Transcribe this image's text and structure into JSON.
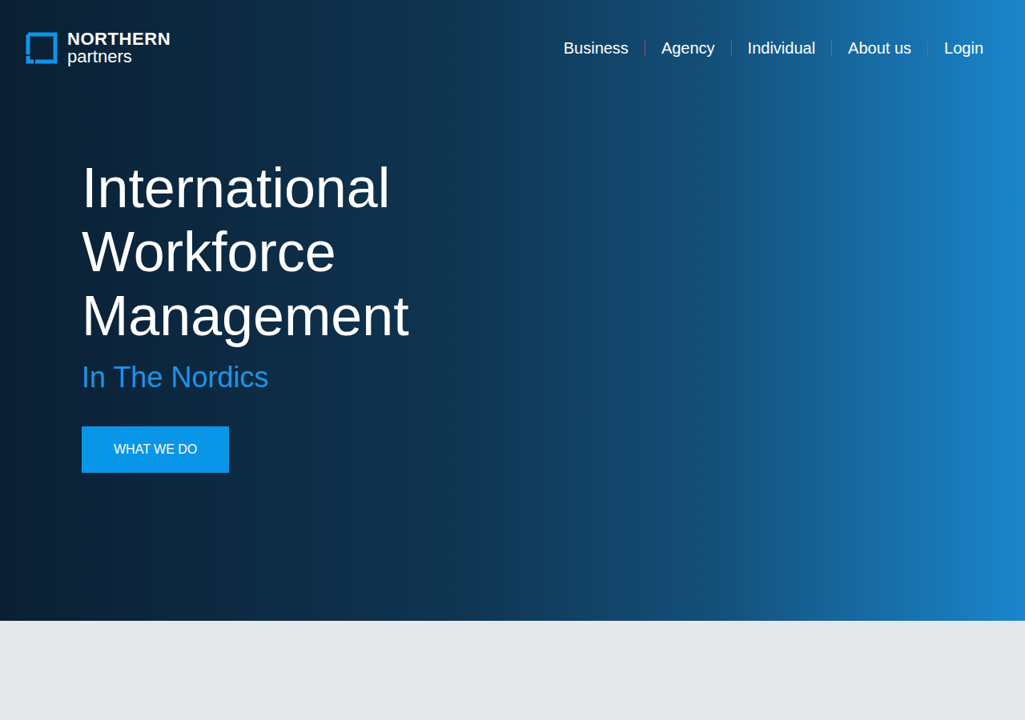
{
  "logo": {
    "name": "NORTHERN",
    "tagline": "partners"
  },
  "nav": {
    "items": [
      {
        "label": "Business"
      },
      {
        "label": "Agency"
      },
      {
        "label": "Individual"
      },
      {
        "label": "About us"
      },
      {
        "label": "Login"
      }
    ]
  },
  "hero": {
    "title_lines": [
      "International",
      "Workforce",
      "Management"
    ],
    "subtitle": "In The Nordics",
    "button": "WHAT WE DO"
  }
}
